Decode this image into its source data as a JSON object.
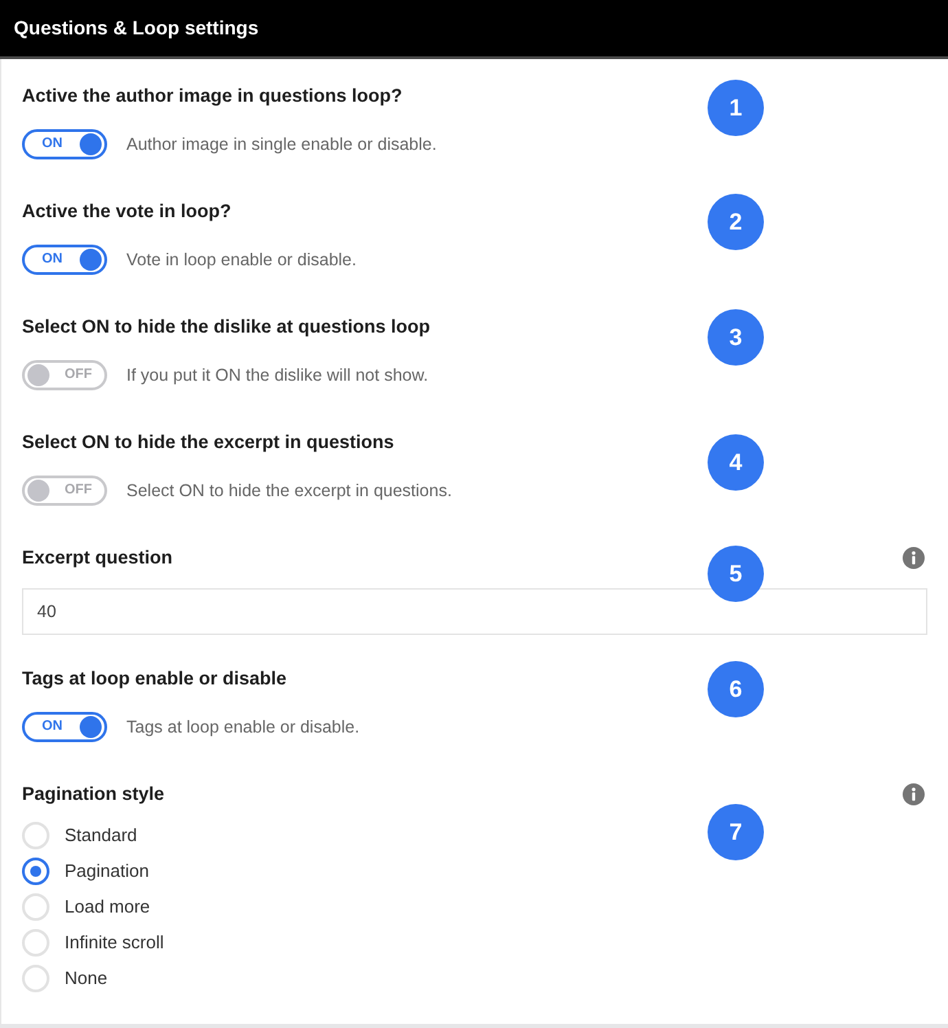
{
  "header": {
    "title": "Questions & Loop settings"
  },
  "settings": [
    {
      "kind": "toggle",
      "title": "Active the author image in questions loop?",
      "on": true,
      "toggle_label": "ON",
      "description": "Author image in single enable or disable.",
      "badge": "1"
    },
    {
      "kind": "toggle",
      "title": "Active the vote in loop?",
      "on": true,
      "toggle_label": "ON",
      "description": "Vote in loop enable or disable.",
      "badge": "2"
    },
    {
      "kind": "toggle",
      "title": "Select ON to hide the dislike at questions loop",
      "on": false,
      "toggle_label": "OFF",
      "description": "If you put it ON the dislike will not show.",
      "badge": "3"
    },
    {
      "kind": "toggle",
      "title": "Select ON to hide the excerpt in questions",
      "on": false,
      "toggle_label": "OFF",
      "description": "Select ON to hide the excerpt in questions.",
      "badge": "4"
    },
    {
      "kind": "number",
      "title": "Excerpt question",
      "info": true,
      "value": "40",
      "badge": "5"
    },
    {
      "kind": "toggle",
      "title": "Tags at loop enable or disable",
      "on": true,
      "toggle_label": "ON",
      "description": "Tags at loop enable or disable.",
      "badge": "6"
    },
    {
      "kind": "radio",
      "title": "Pagination style",
      "info": true,
      "options": [
        {
          "label": "Standard",
          "selected": false
        },
        {
          "label": "Pagination",
          "selected": true
        },
        {
          "label": "Load more",
          "selected": false
        },
        {
          "label": "Infinite scroll",
          "selected": false
        },
        {
          "label": "None",
          "selected": false
        }
      ],
      "badge": "7"
    }
  ]
}
